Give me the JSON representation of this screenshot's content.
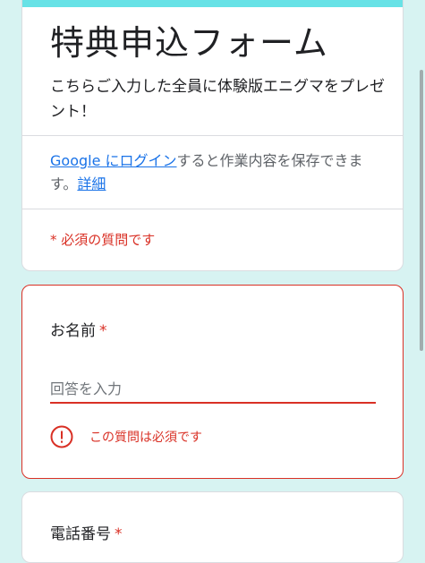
{
  "form": {
    "title": "特典申込フォーム",
    "description": "こちらご入力した全員に体験版エニグマをプレゼント！",
    "login": {
      "link_text": "Google にログイン",
      "suffix_text": "すると作業内容を保存できます。",
      "details_link": "詳細"
    },
    "required_note": "* 必須の質問です"
  },
  "questions": [
    {
      "label": "お名前",
      "required_mark": "*",
      "placeholder": "回答を入力",
      "error_text": "この質問は必須です"
    },
    {
      "label": "電話番号",
      "required_mark": "*"
    }
  ],
  "colors": {
    "background": "#d7f3f2",
    "accent": "#67e2e6",
    "error": "#d93025",
    "link": "#1a73e8"
  },
  "icons": {
    "error": "error-circle-icon"
  }
}
